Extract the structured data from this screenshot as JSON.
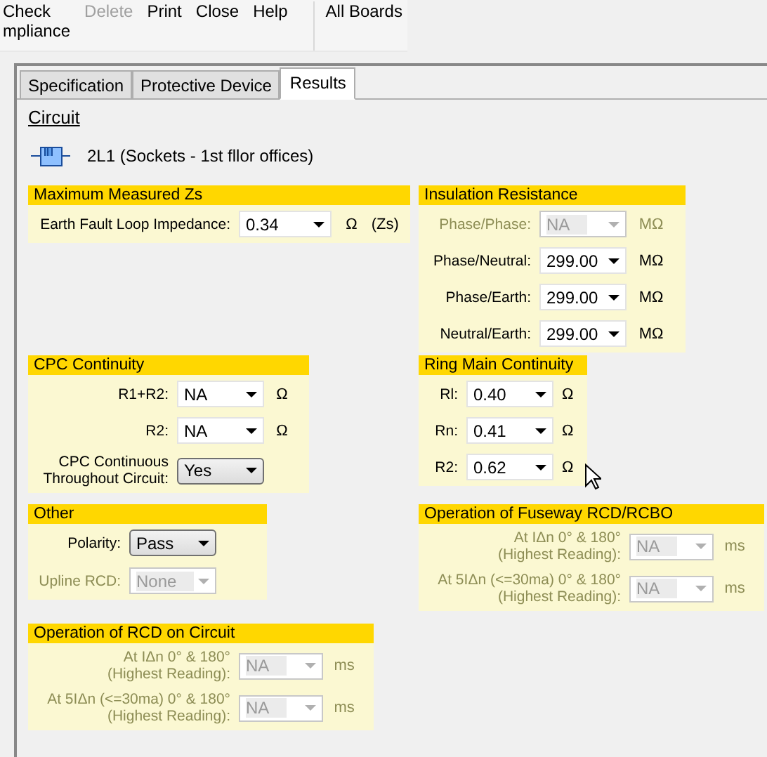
{
  "toolbar": {
    "items": [
      {
        "lines": [
          "Check",
          "mpliance"
        ],
        "disabled": false
      },
      {
        "lines": [
          "Delete"
        ],
        "disabled": true
      },
      {
        "lines": [
          "Print"
        ],
        "disabled": false
      },
      {
        "lines": [
          "Close"
        ],
        "disabled": false
      },
      {
        "lines": [
          "Help"
        ],
        "disabled": false
      }
    ],
    "boards_label": "All Boards"
  },
  "tabs": [
    {
      "label": "Specification",
      "selected": false
    },
    {
      "label": "Protective Device",
      "selected": false
    },
    {
      "label": "Results",
      "selected": true
    }
  ],
  "circuit": {
    "heading": "Circuit",
    "name": "2L1 (Sockets - 1st fllor offices)"
  },
  "groups": [
    {
      "title": "Maximum Measured Zs",
      "rows": [
        {
          "label": "Earth Fault Loop Impedance:",
          "value": "0.34",
          "unit": "Ω",
          "suffix": "(Zs)",
          "kind": "combo",
          "disabled": false
        }
      ]
    },
    {
      "title": "Insulation Resistance",
      "rows": [
        {
          "label": "Phase/Phase:",
          "value": "NA",
          "unit": "MΩ",
          "kind": "combo",
          "disabled": true
        },
        {
          "label": "Phase/Neutral:",
          "value": "299.00",
          "unit": "MΩ",
          "kind": "combo",
          "disabled": false
        },
        {
          "label": "Phase/Earth:",
          "value": "299.00",
          "unit": "MΩ",
          "kind": "combo",
          "disabled": false
        },
        {
          "label": "Neutral/Earth:",
          "value": "299.00",
          "unit": "MΩ",
          "kind": "combo",
          "disabled": false
        }
      ]
    },
    {
      "title": "CPC Continuity",
      "rows": [
        {
          "label": "R1+R2:",
          "value": "NA",
          "unit": "Ω",
          "kind": "combo",
          "disabled": false
        },
        {
          "label": "R2:",
          "value": "NA",
          "unit": "Ω",
          "kind": "combo",
          "disabled": false
        },
        {
          "label": "CPC Continuous\nThroughout Circuit:",
          "value": "Yes",
          "kind": "list",
          "disabled": false
        }
      ]
    },
    {
      "title": "Ring Main Continuity",
      "rows": [
        {
          "label": "Rl:",
          "value": "0.40",
          "unit": "Ω",
          "kind": "combo",
          "disabled": false
        },
        {
          "label": "Rn:",
          "value": "0.41",
          "unit": "Ω",
          "kind": "combo",
          "disabled": false
        },
        {
          "label": "R2:",
          "value": "0.62",
          "unit": "Ω",
          "kind": "combo",
          "disabled": false
        }
      ]
    },
    {
      "title": "Other",
      "rows": [
        {
          "label": "Polarity:",
          "value": "Pass",
          "kind": "list",
          "disabled": false
        },
        {
          "label": "Upline RCD:",
          "value": "None",
          "kind": "combo",
          "disabled": true
        }
      ]
    },
    {
      "title": "Operation of Fuseway RCD/RCBO",
      "rows": [
        {
          "label": "At IΔn 0° & 180°\n(Highest Reading):",
          "value": "NA",
          "unit": "ms",
          "kind": "combo",
          "disabled": true
        },
        {
          "label": "At 5IΔn (<=30ma) 0° & 180°\n(Highest Reading):",
          "value": "NA",
          "unit": "ms",
          "kind": "combo",
          "disabled": true
        }
      ]
    },
    {
      "title": "Operation of RCD on Circuit",
      "rows": [
        {
          "label": "At IΔn 0° & 180°\n(Highest Reading):",
          "value": "NA",
          "unit": "ms",
          "kind": "combo",
          "disabled": true
        },
        {
          "label": "At 5IΔn (<=30ma) 0° & 180°\n(Highest Reading):",
          "value": "NA",
          "unit": "ms",
          "kind": "combo",
          "disabled": true
        }
      ]
    }
  ]
}
